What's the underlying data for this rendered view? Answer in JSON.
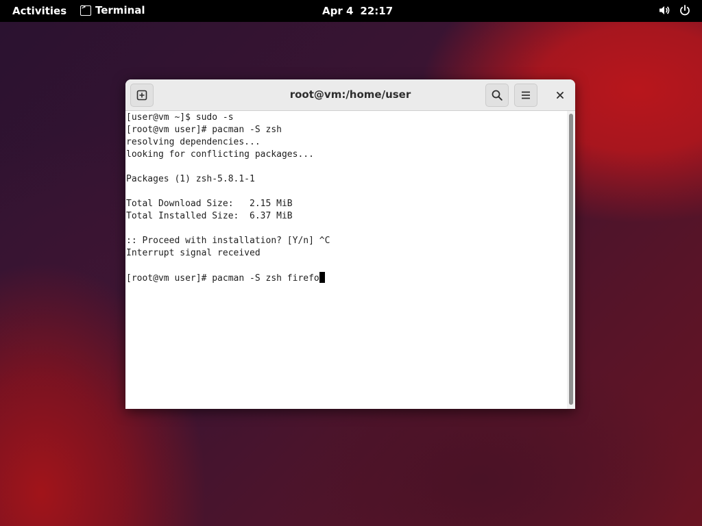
{
  "topbar": {
    "activities": "Activities",
    "app_name": "Terminal",
    "date": "Apr 4",
    "time": "22:17",
    "icons": [
      "terminal-icon",
      "volume-icon",
      "power-icon"
    ]
  },
  "window": {
    "title": "root@vm:/home/user",
    "buttons": [
      "new-tab-icon",
      "search-icon",
      "hamburger-menu-icon",
      "close-icon"
    ]
  },
  "terminal": {
    "lines": [
      "[user@vm ~]$ sudo -s",
      "[root@vm user]# pacman -S zsh",
      "resolving dependencies...",
      "looking for conflicting packages...",
      "",
      "Packages (1) zsh-5.8.1-1",
      "",
      "Total Download Size:   2.15 MiB",
      "Total Installed Size:  6.37 MiB",
      "",
      ":: Proceed with installation? [Y/n] ^C",
      "Interrupt signal received",
      "",
      "[root@vm user]# pacman -S zsh firefo"
    ]
  },
  "colors": {
    "topbar_bg": "#000000",
    "headerbar_bg": "#ebebeb",
    "terminal_bg": "#ffffff",
    "terminal_fg": "#1e1e1e",
    "wallpaper_accent": "#b8161c"
  }
}
